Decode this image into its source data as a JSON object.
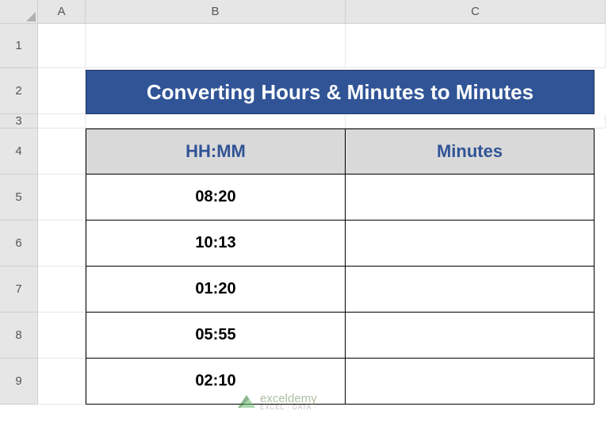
{
  "columns": {
    "A": "A",
    "B": "B",
    "C": "C"
  },
  "rows": {
    "1": "1",
    "2": "2",
    "3": "3",
    "4": "4",
    "5": "5",
    "6": "6",
    "7": "7",
    "8": "8",
    "9": "9"
  },
  "title": "Converting Hours & Minutes to Minutes",
  "headers": {
    "hhmm": "HH:MM",
    "minutes": "Minutes"
  },
  "data": [
    {
      "hhmm": "08:20",
      "minutes": ""
    },
    {
      "hhmm": "10:13",
      "minutes": ""
    },
    {
      "hhmm": "01:20",
      "minutes": ""
    },
    {
      "hhmm": "05:55",
      "minutes": ""
    },
    {
      "hhmm": "02:10",
      "minutes": ""
    }
  ],
  "watermark": {
    "brand": "exceldemy",
    "tag": "EXCEL · DATA · "
  }
}
